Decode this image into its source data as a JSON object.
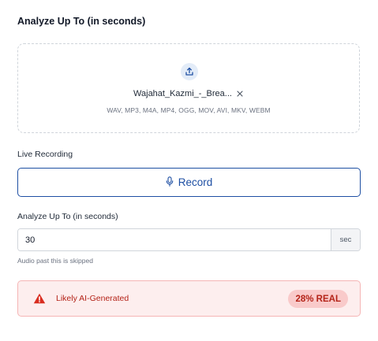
{
  "upload_section": {
    "title": "Analyze Up To (in seconds)",
    "file_name": "Wajahat_Kazmi_-_Brea...",
    "formats": "WAV, MP3, M4A, MP4, OGG, MOV, AVI, MKV, WEBM"
  },
  "live_recording": {
    "label": "Live Recording",
    "button_label": "Record"
  },
  "analyze": {
    "label": "Analyze Up To (in seconds)",
    "value": "30",
    "unit": "sec",
    "hint": "Audio past this is skipped"
  },
  "result": {
    "text": "Likely AI-Generated",
    "badge": "28% REAL"
  },
  "colors": {
    "accent": "#1e4fa3",
    "danger": "#b42318",
    "danger_bg": "#fdeeee"
  },
  "icons": {
    "upload": "upload-icon",
    "remove": "close-icon",
    "record": "microphone-icon",
    "warning": "warning-icon"
  }
}
